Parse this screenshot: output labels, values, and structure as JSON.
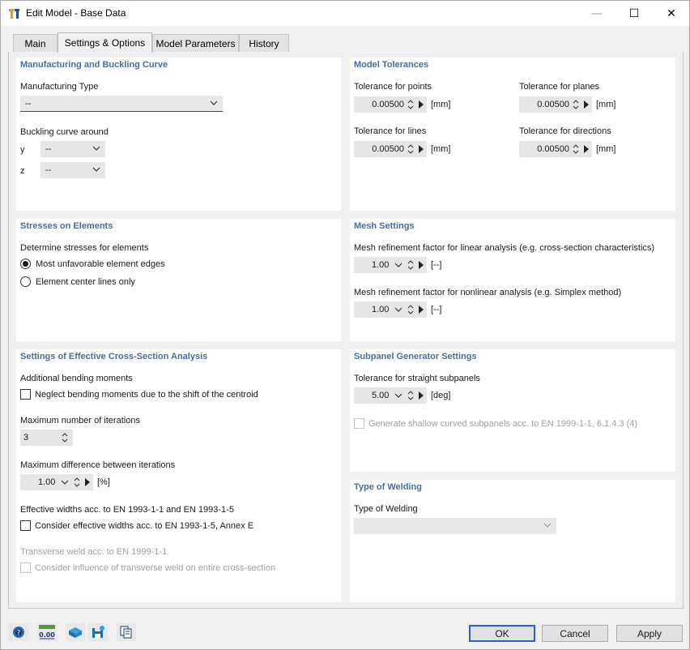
{
  "window": {
    "title": "Edit Model - Base Data",
    "minimize_glyph": "—",
    "maximize_glyph": "☐",
    "close_glyph": "✕"
  },
  "tabs": [
    {
      "label": "Main",
      "active": false
    },
    {
      "label": "Settings & Options",
      "active": true
    },
    {
      "label": "Model Parameters",
      "active": false
    },
    {
      "label": "History",
      "active": false
    }
  ],
  "manufacturing": {
    "title": "Manufacturing and Buckling Curve",
    "type_label": "Manufacturing Type",
    "type_value": "--",
    "buckling_label": "Buckling curve around",
    "y_label": "y",
    "y_value": "--",
    "z_label": "z",
    "z_value": "--"
  },
  "tolerances": {
    "title": "Model Tolerances",
    "points_label": "Tolerance for points",
    "points_value": "0.00500",
    "planes_label": "Tolerance for planes",
    "planes_value": "0.00500",
    "lines_label": "Tolerance for lines",
    "lines_value": "0.00500",
    "directions_label": "Tolerance for directions",
    "directions_value": "0.00500",
    "unit": "[mm]"
  },
  "stresses": {
    "title": "Stresses on Elements",
    "determine_label": "Determine stresses for elements",
    "option1": "Most unfavorable element edges",
    "option1_checked": true,
    "option2": "Element center lines only",
    "option2_checked": false
  },
  "mesh": {
    "title": "Mesh Settings",
    "linear_label": "Mesh refinement factor for linear analysis (e.g. cross-section characteristics)",
    "linear_value": "1.00",
    "nonlinear_label": "Mesh refinement factor for nonlinear analysis (e.g. Simplex method)",
    "nonlinear_value": "1.00",
    "unit": "[--]"
  },
  "effective": {
    "title": "Settings of Effective Cross-Section Analysis",
    "bending_label": "Additional bending moments",
    "neglect_label": "Neglect bending moments due to the shift of the centroid",
    "max_iter_label": "Maximum number of iterations",
    "max_iter_value": "3",
    "max_diff_label": "Maximum difference between iterations",
    "max_diff_value": "1.00",
    "max_diff_unit": "[%]",
    "widths_label": "Effective widths acc. to EN 1993-1-1 and EN 1993-1-5",
    "consider_widths_label": "Consider effective widths acc. to EN 1993-1-5, Annex E",
    "transverse_label": "Transverse weld acc. to EN 1999-1-1",
    "transverse_consider_label": "Consider influence of transverse weld on entire cross-section"
  },
  "subpanel": {
    "title": "Subpanel Generator Settings",
    "tolerance_label": "Tolerance for straight subpanels",
    "tolerance_value": "5.00",
    "unit": "[deg]",
    "generate_label": "Generate shallow curved subpanels acc. to EN 1999-1-1, 6.1.4.3 (4)"
  },
  "welding": {
    "title": "Type of Welding",
    "type_label": "Type of Welding",
    "type_value": ""
  },
  "footer": {
    "tools": [
      "help-icon",
      "units-icon",
      "model-icon",
      "save-icon",
      "copy-icon"
    ],
    "units_icon_text": "0.00",
    "ok_label": "OK",
    "cancel_label": "Cancel",
    "apply_label": "Apply"
  },
  "colors": {
    "section_title": "#4a6d9c",
    "ok_border": "#2f5ec7",
    "panel_bg": "#ffffff",
    "dialog_bg": "#f0f0f0"
  }
}
